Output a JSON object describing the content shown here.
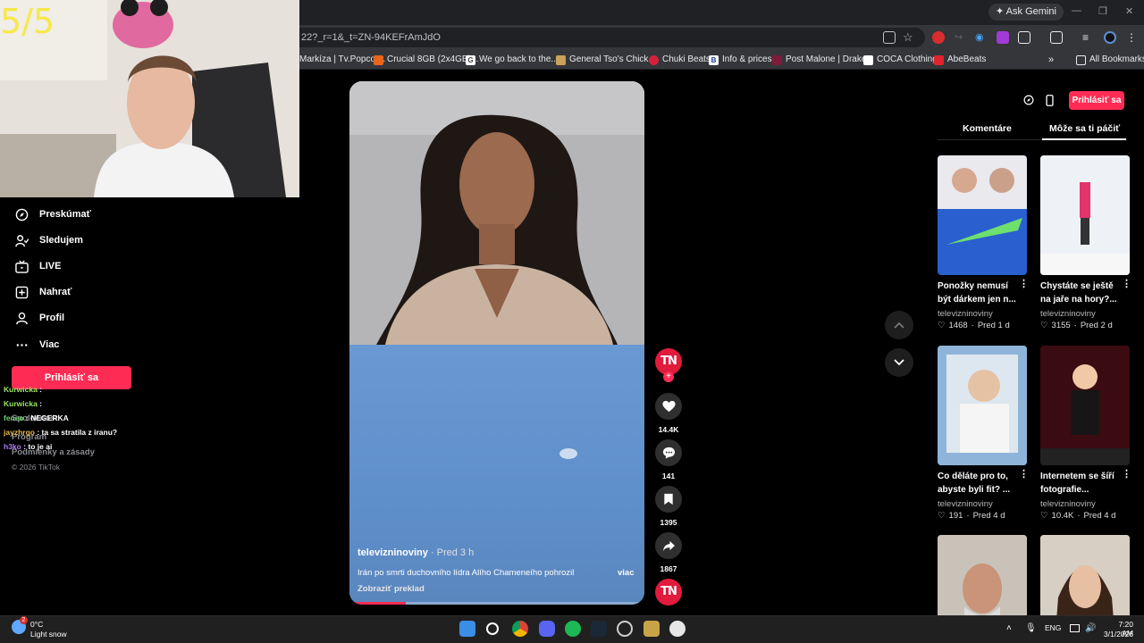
{
  "browser": {
    "ask_gemini": "Ask Gemini",
    "url": "22?_r=1&_t=ZN-94KEFrAmJdO",
    "bookmarks": [
      {
        "label": "Markíza | Tv.Popcor..."
      },
      {
        "label": "Crucial 8GB (2x4GB)..."
      },
      {
        "label": "We go back to the..."
      },
      {
        "label": "General Tso's Chick..."
      },
      {
        "label": "Chuki Beats"
      },
      {
        "label": "Info & prices"
      },
      {
        "label": "Post Malone | Drake..."
      },
      {
        "label": "COCA Clothing"
      },
      {
        "label": "AbeBeats"
      }
    ],
    "more_bookmarks": "»",
    "all_bookmarks": "All Bookmarks"
  },
  "webcam": {
    "counter": "5/5"
  },
  "sidebar": {
    "items": [
      {
        "label": "Preskúmať",
        "icon": "compass-icon"
      },
      {
        "label": "Sledujem",
        "icon": "following-icon"
      },
      {
        "label": "LIVE",
        "icon": "live-icon"
      },
      {
        "label": "Nahrať",
        "icon": "upload-icon"
      },
      {
        "label": "Profil",
        "icon": "profile-icon"
      },
      {
        "label": "Viac",
        "icon": "more-icon"
      }
    ],
    "login": "Prihlásiť sa",
    "footer": {
      "company": "Spoločnosť",
      "program": "Program",
      "terms": "Podmienky a zásady",
      "copyright": "© 2026 TikTok"
    }
  },
  "chat": [
    {
      "user": "Kurwicka",
      "sep": " :",
      "msg": "",
      "color": "#9be564"
    },
    {
      "user": "Kurwicka",
      "sep": " :",
      "msg": "",
      "color": "#9be564"
    },
    {
      "user": "feneo",
      "sep": " :",
      "msg": "NEGERKA",
      "color": "#6fd16f"
    },
    {
      "user": "jayzhrgo",
      "sep": " :",
      "msg": "ta sa stratila z iranu?",
      "color": "#e6b84a"
    },
    {
      "user": "h3ko",
      "sep": " :",
      "msg": "to je ai",
      "color": "#b07cf0"
    }
  ],
  "video": {
    "author": "televizninoviny",
    "time": " · Pred 3 h",
    "description": "Irán po smrti duchovního lídra Alího Chameneího pohrozil",
    "more": "viac",
    "translate": "Zobraziť preklad",
    "progress": 0.19
  },
  "actions": {
    "avatar": "TN",
    "follow": "+",
    "likes": "14.4K",
    "comments": "141",
    "saves": "1395",
    "shares": "1867"
  },
  "right_panel": {
    "login": "Prihlásiť sa",
    "tabs": {
      "comments": "Komentáre",
      "you_may_like": "Môže sa ti páčiť"
    },
    "cards": [
      {
        "title": "Ponožky nemusí být dárkem jen n...",
        "author": "televizninoviny",
        "likes": "1468",
        "age": "Pred 1 d",
        "thumb_color": "#2a5fcf"
      },
      {
        "title": "Chystáte se ještě na jaře na hory?...",
        "author": "televizninoviny",
        "likes": "3155",
        "age": "Pred 2 d",
        "thumb_color": "#dfe6ef"
      },
      {
        "title": "Co děláte pro to, abyste byli fit? ...",
        "author": "televizninoviny",
        "likes": "191",
        "age": "Pred 4 d",
        "thumb_color": "#8fb4d9"
      },
      {
        "title": "Internetem se šíří fotografie...",
        "author": "televizninoviny",
        "likes": "10.4K",
        "age": "Pred 4 d",
        "thumb_color": "#4a0f14"
      },
      {
        "title": "",
        "author": "",
        "likes": "",
        "age": "",
        "thumb_color": "#c9c2b9"
      },
      {
        "title": "",
        "author": "",
        "likes": "",
        "age": "",
        "thumb_color": "#d8cfc4"
      }
    ]
  },
  "taskbar": {
    "weather_temp": "0°C",
    "weather_desc": "Light snow",
    "weather_badge": "2",
    "lang": "ENG",
    "time": "7:20 AM",
    "date": "3/1/2026"
  },
  "colors": {
    "accent": "#fe2c55",
    "tn_red": "#e01b3c",
    "cam_counter": "#f7e84a"
  }
}
